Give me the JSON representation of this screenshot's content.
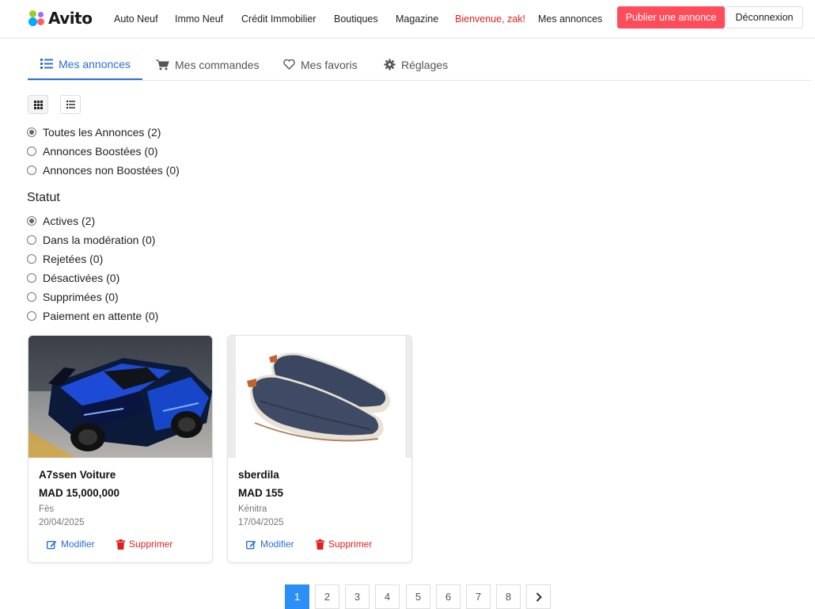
{
  "header": {
    "logo_text": "Avito",
    "nav": [
      "Auto Neuf",
      "Immo Neuf",
      "Crédit Immobilier",
      "Boutiques",
      "Magazine",
      "Bienvenue, zak!",
      "Mes annonces"
    ],
    "publish_label": "Publier une annonce",
    "logout_label": "Déconnexion",
    "colors": {
      "publish_bg": "#ff4c5b",
      "welcome": "#e02020",
      "accent": "#2b6fd6"
    }
  },
  "tabs": [
    {
      "label": "Mes annonces",
      "icon": "list-icon",
      "active": true
    },
    {
      "label": "Mes commandes",
      "icon": "cart-icon",
      "active": false
    },
    {
      "label": "Mes favoris",
      "icon": "heart-icon",
      "active": false
    },
    {
      "label": "Réglages",
      "icon": "gear-icon",
      "active": false
    }
  ],
  "view_toggle": {
    "grid_icon": "grid-icon",
    "list_icon": "list-icon",
    "selected": "grid"
  },
  "filters": [
    {
      "label": "Toutes les Annonces (2)",
      "checked": true
    },
    {
      "label": "Annonces Boostées (0)",
      "checked": false
    },
    {
      "label": "Annonces non Boostées (0)",
      "checked": false
    }
  ],
  "status": {
    "title": "Statut",
    "options": [
      {
        "label": "Actives (2)",
        "checked": true
      },
      {
        "label": "Dans la modération (0)",
        "checked": false
      },
      {
        "label": "Rejetées (0)",
        "checked": false
      },
      {
        "label": "Désactivées (0)",
        "checked": false
      },
      {
        "label": "Supprimées (0)",
        "checked": false
      },
      {
        "label": "Paiement en attente (0)",
        "checked": false
      }
    ]
  },
  "listings": [
    {
      "title": "A7ssen Voiture",
      "price": "MAD 15,000,000",
      "city": "Fès",
      "date": "20/04/2025",
      "image": "blue-sports-car-photo",
      "edit_label": "Modifier",
      "delete_label": "Supprimer"
    },
    {
      "title": "sberdila",
      "price": "MAD 155",
      "city": "Kénitra",
      "date": "17/04/2025",
      "image": "navy-espadrille-shoes-photo",
      "edit_label": "Modifier",
      "delete_label": "Supprimer"
    }
  ],
  "pagination": {
    "pages": [
      "1",
      "2",
      "3",
      "4",
      "5",
      "6",
      "7",
      "8"
    ],
    "current": "1",
    "next_icon": "chevron-right-icon"
  }
}
